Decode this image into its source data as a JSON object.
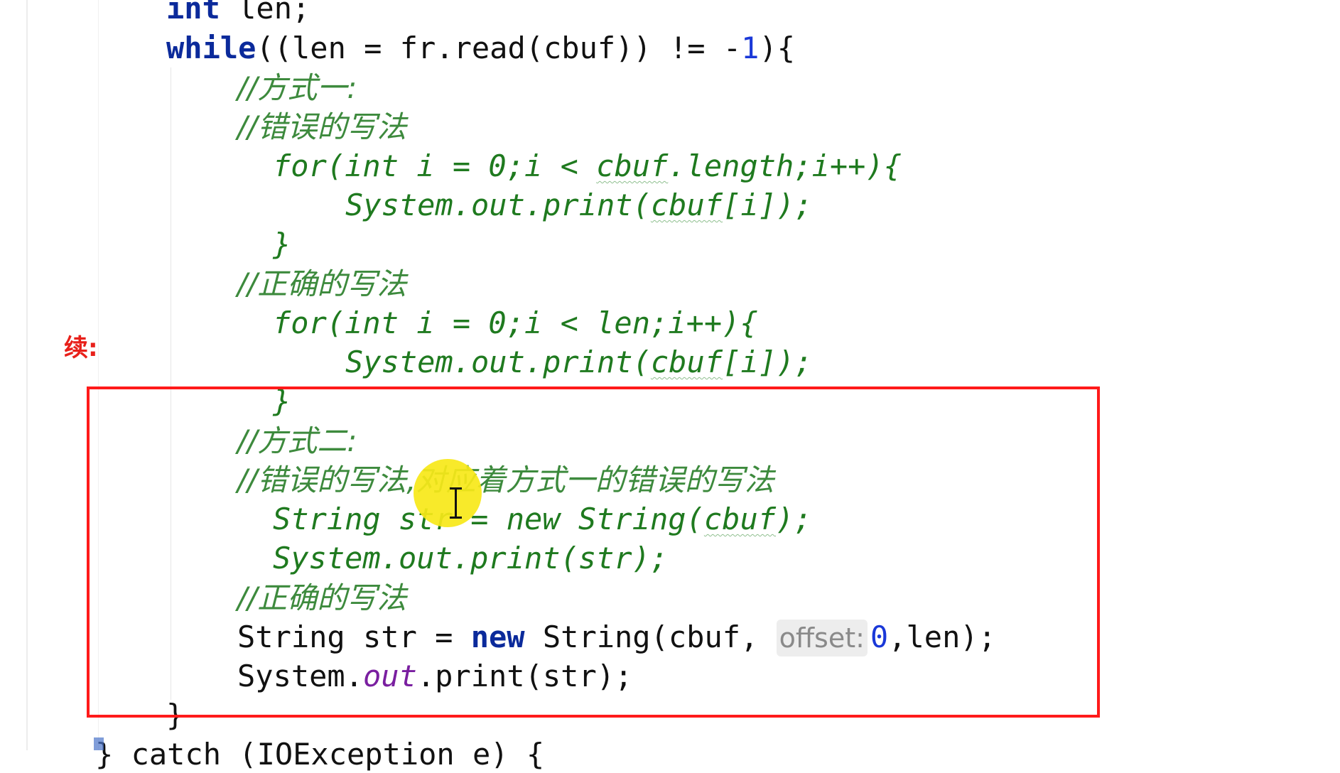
{
  "side_label": "续:",
  "lines": {
    "l1": {
      "kw": "int",
      "rest": " len;"
    },
    "l2": {
      "kw": "while",
      "a": "((len = fr.read(cbuf)) != -",
      "num": "1",
      "b": "){"
    },
    "l3": {
      "comment": "//方式一:"
    },
    "l4": {
      "comment": "//错误的写法"
    },
    "l5": {
      "a": "for(int i = 0;i < ",
      "sq": "cbuf",
      "b": ".length;i++){"
    },
    "l6": {
      "a": "System.out.print(",
      "sq": "cbuf",
      "b": "[i]);"
    },
    "l7": {
      "text": "}"
    },
    "l8": {
      "comment": "//正确的写法"
    },
    "l9": {
      "text": "for(int i = 0;i < len;i++){"
    },
    "l10": {
      "a": "System.out.print(",
      "sq": "cbuf",
      "b": "[i]);"
    },
    "l11": {
      "text": "}"
    },
    "l12": {
      "comment": "//方式二:"
    },
    "l13": {
      "comment": "//错误的写法,对应着方式一的错误的写法"
    },
    "l14": {
      "a": "String str = new String(",
      "sq": "cbuf",
      "b": ");"
    },
    "l15": {
      "text": "System.out.print(str);"
    },
    "l16": {
      "comment": "//正确的写法"
    },
    "l17": {
      "a": "String str = ",
      "kw": "new",
      "b": " String(cbuf, ",
      "hint": "offset:",
      "num": "0",
      "c": ",len);"
    },
    "l18": {
      "a": "System.",
      "field": "out",
      "b": ".print(str);"
    },
    "l19": {
      "text": "}"
    },
    "l20": {
      "text": "} catch (IOException e) {"
    }
  },
  "colors": {
    "highlight_box": "#ff1a1a",
    "cursor_halo": "#f7e818",
    "side_label": "#e8201a"
  }
}
